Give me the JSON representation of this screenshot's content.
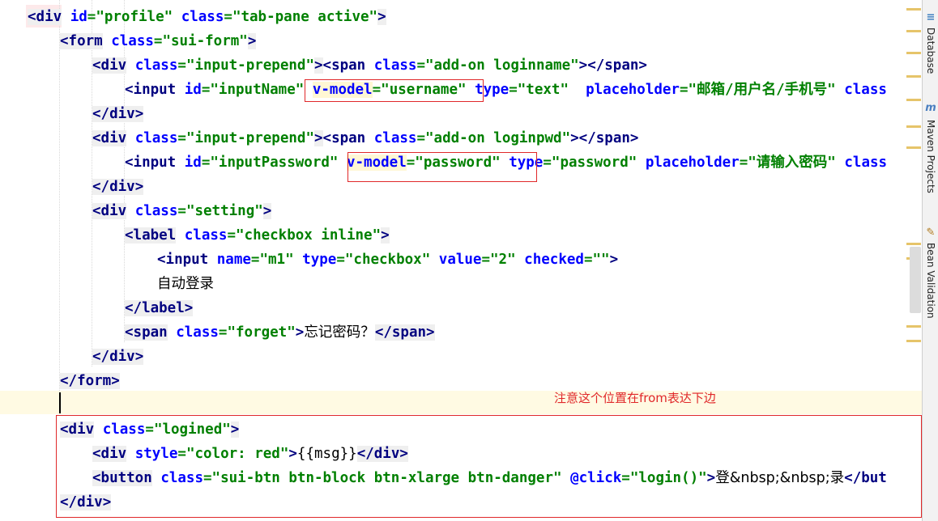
{
  "editor": {
    "lines": [
      [
        "<div",
        " ",
        "id",
        "=",
        "\"profile\"",
        " ",
        "class",
        "=",
        "\"tab-pane active\"",
        ">"
      ],
      [
        "<form",
        " ",
        "class",
        "=",
        "\"sui-form\"",
        ">"
      ],
      [
        "<div",
        " ",
        "class",
        "=",
        "\"input-prepend\"",
        ">",
        "<span",
        " ",
        "class",
        "=",
        "\"add-on loginname\"",
        ">",
        "</span",
        ">"
      ],
      [
        "<input",
        " ",
        "id",
        "=",
        "\"inputName\"",
        " ",
        "v-model",
        "=",
        "\"username\"",
        " ",
        "type",
        "=",
        "\"text\"",
        "  ",
        "placeholder",
        "=",
        "\"邮箱/用户名/手机号\"",
        " ",
        "class"
      ],
      [
        "</div",
        ">"
      ],
      [
        "<div",
        " ",
        "class",
        "=",
        "\"input-prepend\"",
        ">",
        "<span",
        " ",
        "class",
        "=",
        "\"add-on loginpwd\"",
        ">",
        "</span",
        ">"
      ],
      [
        "<input",
        " ",
        "id",
        "=",
        "\"inputPassword\"",
        " ",
        "v-model",
        "=",
        "\"password\"",
        " ",
        "type",
        "=",
        "\"password\"",
        " ",
        "placeholder",
        "=",
        "\"请输入密码\"",
        " ",
        "class"
      ],
      [
        "</div",
        ">"
      ],
      [
        "<div",
        " ",
        "class",
        "=",
        "\"setting\"",
        ">"
      ],
      [
        "<label",
        " ",
        "class",
        "=",
        "\"checkbox inline\"",
        ">"
      ],
      [
        "<input",
        " ",
        "name",
        "=",
        "\"m1\"",
        " ",
        "type",
        "=",
        "\"checkbox\"",
        " ",
        "value",
        "=",
        "\"2\"",
        " ",
        "checked",
        "=",
        "\"\"",
        ">"
      ],
      [
        "自动登录"
      ],
      [
        "</label",
        ">"
      ],
      [
        "<span",
        " ",
        "class",
        "=",
        "\"forget\"",
        ">",
        "忘记密码？",
        "</span",
        ">"
      ],
      [
        "</div",
        ">"
      ],
      [
        "</form",
        ">"
      ],
      [
        ""
      ],
      [
        "<div",
        " ",
        "class",
        "=",
        "\"logined\"",
        ">"
      ],
      [
        "<div",
        " ",
        "style",
        "=",
        "\"color: red\"",
        ">",
        "{{msg}}",
        "</div",
        ">"
      ],
      [
        "<button",
        " ",
        "class",
        "=",
        "\"sui-btn btn-block btn-xlarge btn-danger\"",
        " ",
        "@click",
        "=",
        "\"login()\"",
        ">",
        "登&nbsp;&nbsp;录",
        "</but"
      ],
      [
        "</div",
        ">"
      ]
    ],
    "annotation_note": "注意这个位置在from表达下边"
  },
  "tool_windows": [
    {
      "label": "Database",
      "icon": "database-icon"
    },
    {
      "label": "Maven Projects",
      "icon": "maven-icon"
    },
    {
      "label": "Bean Validation",
      "icon": "bean-validation-icon"
    }
  ],
  "colors": {
    "tag": "#000080",
    "attribute": "#0000ff",
    "value": "#008000",
    "annotation": "#e0282a",
    "caret_line": "#fffae3"
  }
}
